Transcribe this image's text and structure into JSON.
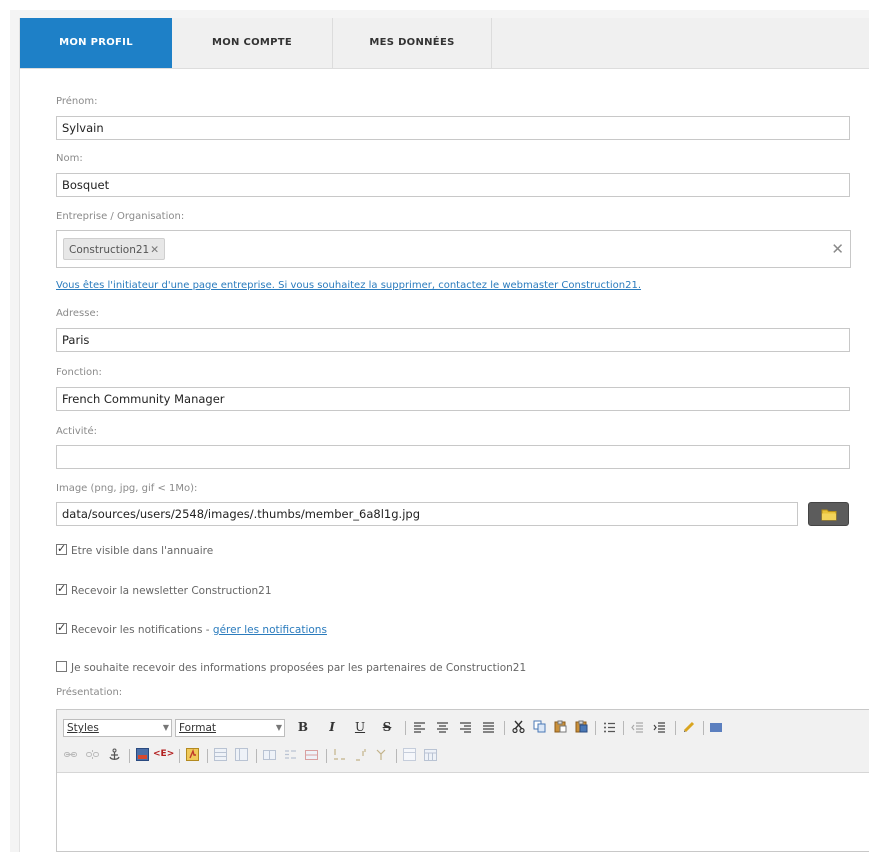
{
  "tabs": [
    {
      "label": "MON PROFIL",
      "active": true
    },
    {
      "label": "MON COMPTE",
      "active": false
    },
    {
      "label": "MES DONNÉES",
      "active": false
    }
  ],
  "form": {
    "prenom_label": "Prénom:",
    "prenom_value": "Sylvain",
    "nom_label": "Nom:",
    "nom_value": "Bosquet",
    "entreprise_label": "Entreprise / Organisation:",
    "entreprise_tag": "Construction21",
    "tag_remove_glyph": "✕",
    "clear_glyph": "✕",
    "notice": "Vous êtes l'initiateur d'une page entreprise. Si vous souhaitez la supprimer, contactez le webmaster Construction21.",
    "adresse_label": "Adresse:",
    "adresse_value": "Paris",
    "fonction_label": "Fonction:",
    "fonction_value": "French Community Manager",
    "activite_label": "Activité:",
    "activite_value": "",
    "image_label": "Image (png, jpg, gif < 1Mo):",
    "image_value": "data/sources/users/2548/images/.thumbs/member_6a8l1g.jpg",
    "presentation_label": "Présentation:"
  },
  "checkboxes": [
    {
      "label": "Etre visible dans l'annuaire",
      "checked": true
    },
    {
      "label": "Recevoir la newsletter Construction21",
      "checked": true
    },
    {
      "label": "Recevoir les notifications - ",
      "checked": true,
      "link": "gérer les notifications"
    },
    {
      "label": "Je souhaite recevoir des informations proposées par les partenaires de Construction21",
      "checked": false
    }
  ],
  "editor": {
    "styles_label": "Styles",
    "format_label": "Format",
    "bold": "B",
    "italic": "I",
    "underline": "U",
    "strike": "S",
    "tag_button": "<E>"
  },
  "colors": {
    "accent": "#1e80c7",
    "link": "#2a7bbd",
    "border": "#c8c8c8"
  }
}
